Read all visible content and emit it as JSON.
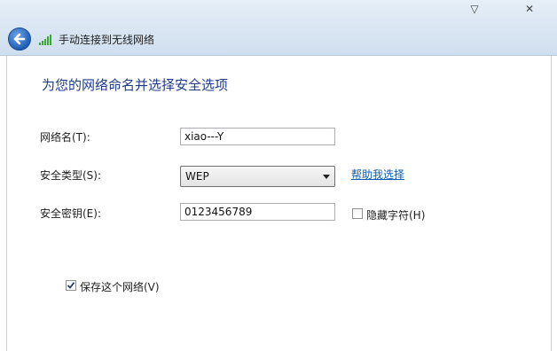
{
  "window": {
    "title": "手动连接到无线网络",
    "controls": {
      "collapse": "▽",
      "close": "✕"
    }
  },
  "page": {
    "heading": "为您的网络命名并选择安全选项"
  },
  "form": {
    "network_name": {
      "label": "网络名(T):",
      "value": "xiao---Y"
    },
    "security_type": {
      "label": "安全类型(S):",
      "value": "WEP",
      "help_link": "帮助我选择"
    },
    "security_key": {
      "label": "安全密钥(E):",
      "value": "0123456789",
      "hide_chars_label": "隐藏字符(H)",
      "hide_chars_checked": false
    },
    "save_network": {
      "label": "保存这个网络(V)",
      "checked": true
    }
  },
  "icons": {
    "back": "back-arrow-icon",
    "signal": "wifi-signal-icon"
  },
  "colors": {
    "heading": "#1d3a8c",
    "link": "#0b5fb3",
    "signal": "#3aa835"
  }
}
